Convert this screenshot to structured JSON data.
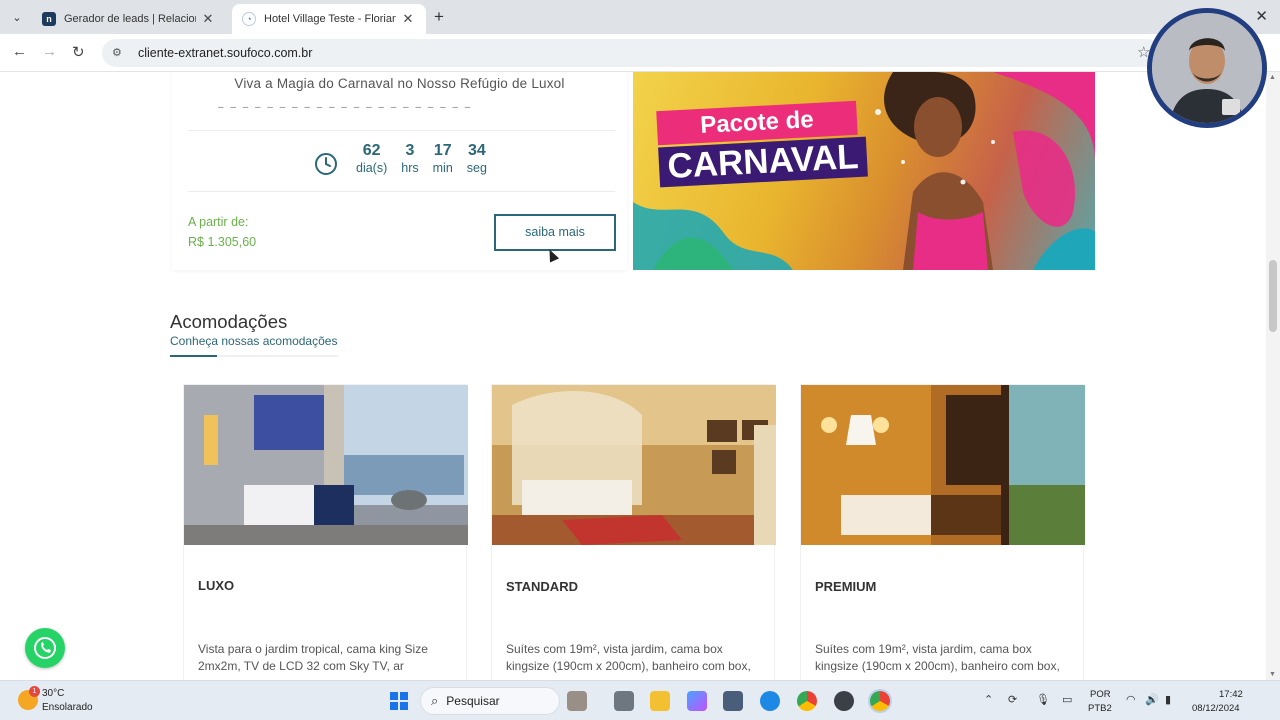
{
  "browser": {
    "tabs": [
      {
        "title": "Gerador de leads | Relacionamento",
        "active": false
      },
      {
        "title": "Hotel Village Teste - Florianópolis",
        "active": true
      }
    ],
    "url": "cliente-extranet.soufoco.com.br"
  },
  "promo": {
    "title": "Viva a Magia do Carnaval no Nosso Refúgio de Luxol",
    "countdown": [
      {
        "value": "62",
        "label": "dia(s)"
      },
      {
        "value": "3",
        "label": "hrs"
      },
      {
        "value": "17",
        "label": "min"
      },
      {
        "value": "34",
        "label": "seg"
      }
    ],
    "price_label": "A partir de:",
    "price_value": "R$ 1.305,60",
    "button_label": "saiba mais",
    "banner_line1": "Pacote de",
    "banner_line2": "CARNAVAL"
  },
  "accommodations": {
    "title": "Acomodações",
    "subtitle": "Conheça nossas acomodações",
    "rooms": [
      {
        "name": "LUXO",
        "description": "Vista para o jardim tropical, cama king Size 2mx2m, TV de LCD 32 com Sky TV, ar"
      },
      {
        "name": "STANDARD",
        "description": "Suítes com 19m², vista jardim, cama box kingsize (190cm x 200cm), banheiro com box,"
      },
      {
        "name": "PREMIUM",
        "description": "Suítes com 19m², vista jardim, cama box kingsize (190cm x 200cm), banheiro com box,"
      }
    ]
  },
  "taskbar": {
    "weather_temp": "30°C",
    "weather_desc": "Ensolarado",
    "weather_badge": "1",
    "search_placeholder": "Pesquisar",
    "lang_line1": "POR",
    "lang_line2": "PTB2",
    "time": "17:42",
    "date": "08/12/2024"
  },
  "colors": {
    "accent": "#2b6777",
    "price": "#6ab04c",
    "whatsapp": "#25d366"
  }
}
